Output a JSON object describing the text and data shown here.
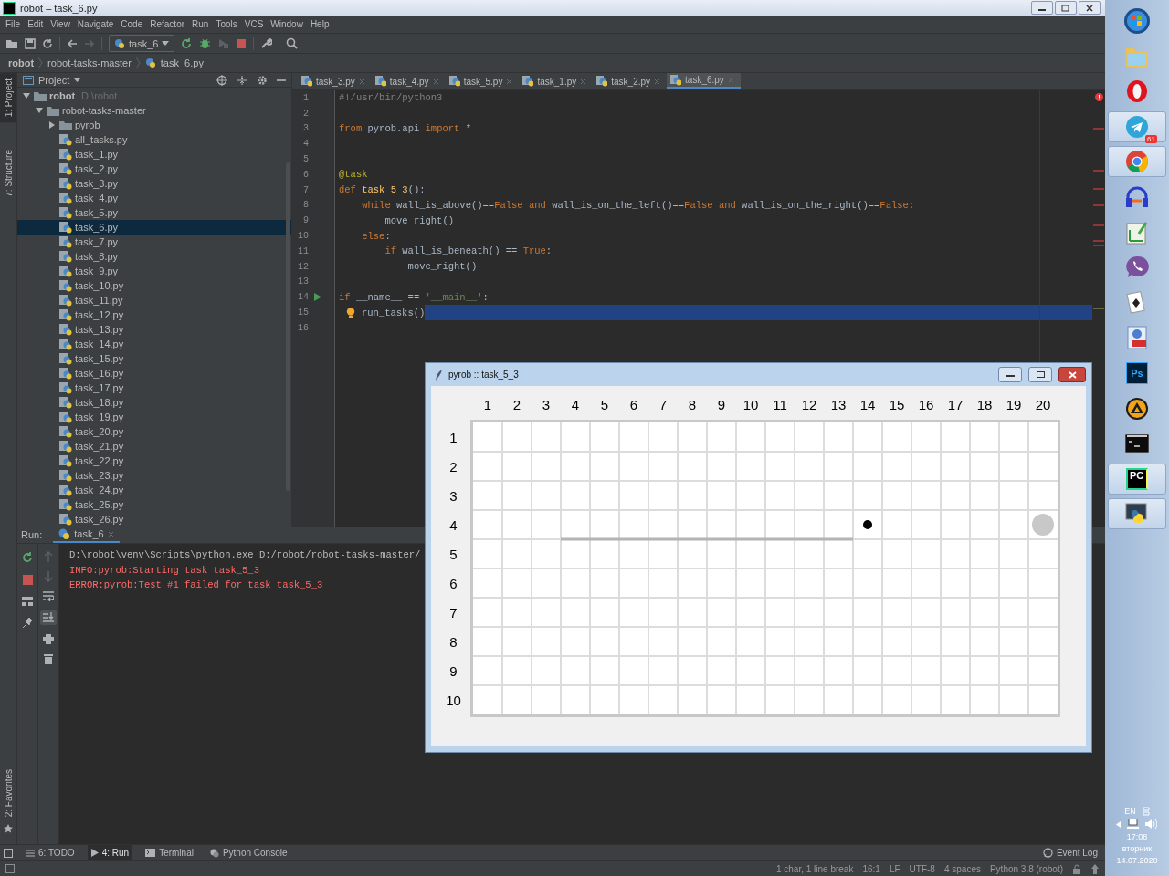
{
  "window": {
    "title": "robot – task_6.py"
  },
  "menu": [
    "File",
    "Edit",
    "View",
    "Navigate",
    "Code",
    "Refactor",
    "Run",
    "Tools",
    "VCS",
    "Window",
    "Help"
  ],
  "toolbar": {
    "run_config": "task_6"
  },
  "breadcrumbs": [
    "robot",
    "robot-tasks-master",
    "task_6.py"
  ],
  "side_tabs": [
    {
      "label": "1: Project",
      "selected": true
    },
    {
      "label": "7: Structure",
      "selected": false
    }
  ],
  "favorites": {
    "label": "2: Favorites"
  },
  "project": {
    "title": "Project",
    "tree": [
      {
        "name": "robot",
        "path": "D:\\robot",
        "kind": "folder",
        "expanded": true,
        "selected": false,
        "children": [
          {
            "name": "robot-tasks-master",
            "kind": "folder",
            "expanded": true,
            "selected": false,
            "children": [
              {
                "name": "pyrob",
                "kind": "folder",
                "expanded": false,
                "selected": false
              },
              {
                "name": "all_tasks.py",
                "kind": "file",
                "selected": false
              },
              {
                "name": "task_1.py",
                "kind": "file",
                "selected": false
              },
              {
                "name": "task_2.py",
                "kind": "file",
                "selected": false
              },
              {
                "name": "task_3.py",
                "kind": "file",
                "selected": false
              },
              {
                "name": "task_4.py",
                "kind": "file",
                "selected": false
              },
              {
                "name": "task_5.py",
                "kind": "file",
                "selected": false
              },
              {
                "name": "task_6.py",
                "kind": "file",
                "selected": true
              },
              {
                "name": "task_7.py",
                "kind": "file",
                "selected": false
              },
              {
                "name": "task_8.py",
                "kind": "file",
                "selected": false
              },
              {
                "name": "task_9.py",
                "kind": "file",
                "selected": false
              },
              {
                "name": "task_10.py",
                "kind": "file",
                "selected": false
              },
              {
                "name": "task_11.py",
                "kind": "file",
                "selected": false
              },
              {
                "name": "task_12.py",
                "kind": "file",
                "selected": false
              },
              {
                "name": "task_13.py",
                "kind": "file",
                "selected": false
              },
              {
                "name": "task_14.py",
                "kind": "file",
                "selected": false
              },
              {
                "name": "task_15.py",
                "kind": "file",
                "selected": false
              },
              {
                "name": "task_16.py",
                "kind": "file",
                "selected": false
              },
              {
                "name": "task_17.py",
                "kind": "file",
                "selected": false
              },
              {
                "name": "task_18.py",
                "kind": "file",
                "selected": false
              },
              {
                "name": "task_19.py",
                "kind": "file",
                "selected": false
              },
              {
                "name": "task_20.py",
                "kind": "file",
                "selected": false
              },
              {
                "name": "task_21.py",
                "kind": "file",
                "selected": false
              },
              {
                "name": "task_22.py",
                "kind": "file",
                "selected": false
              },
              {
                "name": "task_23.py",
                "kind": "file",
                "selected": false
              },
              {
                "name": "task_24.py",
                "kind": "file",
                "selected": false
              },
              {
                "name": "task_25.py",
                "kind": "file",
                "selected": false
              },
              {
                "name": "task_26.py",
                "kind": "file",
                "selected": false
              }
            ]
          }
        ]
      }
    ]
  },
  "editor_tabs": [
    {
      "label": "task_3.py",
      "selected": false
    },
    {
      "label": "task_4.py",
      "selected": false
    },
    {
      "label": "task_5.py",
      "selected": false
    },
    {
      "label": "task_1.py",
      "selected": false
    },
    {
      "label": "task_2.py",
      "selected": false
    },
    {
      "label": "task_6.py",
      "selected": true
    }
  ],
  "code": [
    {
      "number": "1",
      "kind": "plain",
      "selected": false,
      "tokens": [
        {
          "text": "#!/usr/bin/python3",
          "kind": "comment"
        }
      ]
    },
    {
      "number": "2",
      "kind": "plain",
      "selected": false
    },
    {
      "number": "3",
      "kind": "plain",
      "selected": false,
      "tokens": [
        {
          "text": "from",
          "kind": "keyword"
        },
        {
          "text": " pyrob.api ",
          "kind": "plain"
        },
        {
          "text": "import",
          "kind": "keyword"
        },
        {
          "text": " *",
          "kind": "plain"
        }
      ]
    },
    {
      "number": "4",
      "kind": "plain",
      "selected": false
    },
    {
      "number": "5",
      "kind": "plain",
      "selected": false
    },
    {
      "number": "6",
      "kind": "plain",
      "selected": false,
      "tokens": [
        {
          "text": "@task",
          "kind": "decorator"
        }
      ]
    },
    {
      "number": "7",
      "kind": "plain",
      "selected": false,
      "tokens": [
        {
          "text": "def",
          "kind": "keyword"
        },
        {
          "text": " task_5_3",
          "kind": "function"
        },
        {
          "text": "():",
          "kind": "plain"
        }
      ]
    },
    {
      "number": "8",
      "kind": "plain",
      "selected": false,
      "tokens": [
        {
          "text": "    while",
          "kind": "keyword"
        },
        {
          "text": " wall_is_above()==",
          "kind": "plain"
        },
        {
          "text": "False and",
          "kind": "keyword"
        },
        {
          "text": " wall_is_on_the_left()==",
          "kind": "plain"
        },
        {
          "text": "False and",
          "kind": "keyword"
        },
        {
          "text": " wall_is_on_the_right()==",
          "kind": "plain"
        },
        {
          "text": "False",
          "kind": "keyword"
        },
        {
          "text": ":",
          "kind": "plain"
        }
      ]
    },
    {
      "number": "9",
      "kind": "plain",
      "selected": false,
      "tokens": [
        {
          "text": "        move_right()",
          "kind": "plain"
        }
      ]
    },
    {
      "number": "10",
      "kind": "plain",
      "selected": false,
      "tokens": [
        {
          "text": "    else",
          "kind": "keyword"
        },
        {
          "text": ":",
          "kind": "plain"
        }
      ]
    },
    {
      "number": "11",
      "kind": "plain",
      "selected": false,
      "tokens": [
        {
          "text": "        if",
          "kind": "keyword"
        },
        {
          "text": " wall_is_beneath() == ",
          "kind": "plain"
        },
        {
          "text": "True",
          "kind": "keyword"
        },
        {
          "text": ":",
          "kind": "plain"
        }
      ]
    },
    {
      "number": "12",
      "kind": "plain",
      "selected": false,
      "tokens": [
        {
          "text": "            move_right()",
          "kind": "plain"
        }
      ]
    },
    {
      "number": "13",
      "kind": "plain",
      "selected": false
    },
    {
      "number": "14",
      "kind": "runnable",
      "selected": false,
      "tokens": [
        {
          "text": "if",
          "kind": "keyword"
        },
        {
          "text": " __name__ == ",
          "kind": "plain"
        },
        {
          "text": "'__main__'",
          "kind": "string"
        },
        {
          "text": ":",
          "kind": "plain"
        }
      ]
    },
    {
      "number": "15",
      "kind": "hint",
      "selected": true,
      "tokens": [
        {
          "text": "run_tasks()",
          "kind": "plain"
        }
      ]
    },
    {
      "number": "16",
      "kind": "plain",
      "selected": false
    }
  ],
  "run": {
    "label": "Run:",
    "tab": "task_6",
    "console": [
      {
        "text": "D:\\robot\\venv\\Scripts\\python.exe D:/robot/robot-tasks-master/",
        "kind": "stdout"
      },
      {
        "text": "INFO:pyrob:Starting task task_5_3",
        "kind": "stderr"
      },
      {
        "text": "ERROR:pyrob:Test #1 failed for task task_5_3",
        "kind": "stderr"
      }
    ]
  },
  "bottom_tabs": [
    {
      "label": "6: TODO",
      "kind": "todo",
      "selected": false
    },
    {
      "label": "4: Run",
      "kind": "run",
      "selected": true
    },
    {
      "label": "Terminal",
      "kind": "terminal",
      "selected": false
    },
    {
      "label": "Python Console",
      "kind": "console",
      "selected": false
    }
  ],
  "event_log": "Event Log",
  "status_bar": [
    "1 char, 1 line break",
    "16:1",
    "LF",
    "UTF-8",
    "4 spaces",
    "Python 3.8 (robot)"
  ],
  "robot_window": {
    "title": "pyrob :: task_5_3",
    "columns": [
      "1",
      "2",
      "3",
      "4",
      "5",
      "6",
      "7",
      "8",
      "9",
      "10",
      "11",
      "12",
      "13",
      "14",
      "15",
      "16",
      "17",
      "18",
      "19",
      "20"
    ],
    "rows": [
      {
        "label": "1",
        "cells": [
          {
            "kind": "empty"
          },
          {
            "kind": "empty"
          },
          {
            "kind": "empty"
          },
          {
            "kind": "empty"
          },
          {
            "kind": "empty"
          },
          {
            "kind": "empty"
          },
          {
            "kind": "empty"
          },
          {
            "kind": "empty"
          },
          {
            "kind": "empty"
          },
          {
            "kind": "empty"
          },
          {
            "kind": "empty"
          },
          {
            "kind": "empty"
          },
          {
            "kind": "empty"
          },
          {
            "kind": "empty"
          },
          {
            "kind": "empty"
          },
          {
            "kind": "empty"
          },
          {
            "kind": "empty"
          },
          {
            "kind": "empty"
          },
          {
            "kind": "empty"
          },
          {
            "kind": "empty"
          }
        ]
      },
      {
        "label": "2",
        "cells": [
          {
            "kind": "empty"
          },
          {
            "kind": "empty"
          },
          {
            "kind": "empty"
          },
          {
            "kind": "empty"
          },
          {
            "kind": "empty"
          },
          {
            "kind": "empty"
          },
          {
            "kind": "empty"
          },
          {
            "kind": "empty"
          },
          {
            "kind": "empty"
          },
          {
            "kind": "empty"
          },
          {
            "kind": "empty"
          },
          {
            "kind": "empty"
          },
          {
            "kind": "empty"
          },
          {
            "kind": "empty"
          },
          {
            "kind": "empty"
          },
          {
            "kind": "empty"
          },
          {
            "kind": "empty"
          },
          {
            "kind": "empty"
          },
          {
            "kind": "empty"
          },
          {
            "kind": "empty"
          }
        ]
      },
      {
        "label": "3",
        "cells": [
          {
            "kind": "empty"
          },
          {
            "kind": "empty"
          },
          {
            "kind": "empty"
          },
          {
            "kind": "empty"
          },
          {
            "kind": "empty"
          },
          {
            "kind": "empty"
          },
          {
            "kind": "empty"
          },
          {
            "kind": "empty"
          },
          {
            "kind": "empty"
          },
          {
            "kind": "empty"
          },
          {
            "kind": "empty"
          },
          {
            "kind": "empty"
          },
          {
            "kind": "empty"
          },
          {
            "kind": "empty"
          },
          {
            "kind": "empty"
          },
          {
            "kind": "empty"
          },
          {
            "kind": "empty"
          },
          {
            "kind": "empty"
          },
          {
            "kind": "empty"
          },
          {
            "kind": "empty"
          }
        ]
      },
      {
        "label": "4",
        "cells": [
          {
            "kind": "empty"
          },
          {
            "kind": "empty"
          },
          {
            "kind": "empty"
          },
          {
            "kind": "wall_below"
          },
          {
            "kind": "wall_below"
          },
          {
            "kind": "wall_below"
          },
          {
            "kind": "wall_below"
          },
          {
            "kind": "wall_below"
          },
          {
            "kind": "wall_below"
          },
          {
            "kind": "wall_below"
          },
          {
            "kind": "wall_below"
          },
          {
            "kind": "wall_below"
          },
          {
            "kind": "wall_below"
          },
          {
            "kind": "robot"
          },
          {
            "kind": "empty"
          },
          {
            "kind": "empty"
          },
          {
            "kind": "empty"
          },
          {
            "kind": "empty"
          },
          {
            "kind": "empty"
          },
          {
            "kind": "target"
          }
        ]
      },
      {
        "label": "5",
        "cells": [
          {
            "kind": "empty"
          },
          {
            "kind": "empty"
          },
          {
            "kind": "empty"
          },
          {
            "kind": "empty"
          },
          {
            "kind": "empty"
          },
          {
            "kind": "empty"
          },
          {
            "kind": "empty"
          },
          {
            "kind": "empty"
          },
          {
            "kind": "empty"
          },
          {
            "kind": "empty"
          },
          {
            "kind": "empty"
          },
          {
            "kind": "empty"
          },
          {
            "kind": "empty"
          },
          {
            "kind": "empty"
          },
          {
            "kind": "empty"
          },
          {
            "kind": "empty"
          },
          {
            "kind": "empty"
          },
          {
            "kind": "empty"
          },
          {
            "kind": "empty"
          },
          {
            "kind": "empty"
          }
        ]
      },
      {
        "label": "6",
        "cells": [
          {
            "kind": "empty"
          },
          {
            "kind": "empty"
          },
          {
            "kind": "empty"
          },
          {
            "kind": "empty"
          },
          {
            "kind": "empty"
          },
          {
            "kind": "empty"
          },
          {
            "kind": "empty"
          },
          {
            "kind": "empty"
          },
          {
            "kind": "empty"
          },
          {
            "kind": "empty"
          },
          {
            "kind": "empty"
          },
          {
            "kind": "empty"
          },
          {
            "kind": "empty"
          },
          {
            "kind": "empty"
          },
          {
            "kind": "empty"
          },
          {
            "kind": "empty"
          },
          {
            "kind": "empty"
          },
          {
            "kind": "empty"
          },
          {
            "kind": "empty"
          },
          {
            "kind": "empty"
          }
        ]
      },
      {
        "label": "7",
        "cells": [
          {
            "kind": "empty"
          },
          {
            "kind": "empty"
          },
          {
            "kind": "empty"
          },
          {
            "kind": "empty"
          },
          {
            "kind": "empty"
          },
          {
            "kind": "empty"
          },
          {
            "kind": "empty"
          },
          {
            "kind": "empty"
          },
          {
            "kind": "empty"
          },
          {
            "kind": "empty"
          },
          {
            "kind": "empty"
          },
          {
            "kind": "empty"
          },
          {
            "kind": "empty"
          },
          {
            "kind": "empty"
          },
          {
            "kind": "empty"
          },
          {
            "kind": "empty"
          },
          {
            "kind": "empty"
          },
          {
            "kind": "empty"
          },
          {
            "kind": "empty"
          },
          {
            "kind": "empty"
          }
        ]
      },
      {
        "label": "8",
        "cells": [
          {
            "kind": "empty"
          },
          {
            "kind": "empty"
          },
          {
            "kind": "empty"
          },
          {
            "kind": "empty"
          },
          {
            "kind": "empty"
          },
          {
            "kind": "empty"
          },
          {
            "kind": "empty"
          },
          {
            "kind": "empty"
          },
          {
            "kind": "empty"
          },
          {
            "kind": "empty"
          },
          {
            "kind": "empty"
          },
          {
            "kind": "empty"
          },
          {
            "kind": "empty"
          },
          {
            "kind": "empty"
          },
          {
            "kind": "empty"
          },
          {
            "kind": "empty"
          },
          {
            "kind": "empty"
          },
          {
            "kind": "empty"
          },
          {
            "kind": "empty"
          },
          {
            "kind": "empty"
          }
        ]
      },
      {
        "label": "9",
        "cells": [
          {
            "kind": "empty"
          },
          {
            "kind": "empty"
          },
          {
            "kind": "empty"
          },
          {
            "kind": "empty"
          },
          {
            "kind": "empty"
          },
          {
            "kind": "empty"
          },
          {
            "kind": "empty"
          },
          {
            "kind": "empty"
          },
          {
            "kind": "empty"
          },
          {
            "kind": "empty"
          },
          {
            "kind": "empty"
          },
          {
            "kind": "empty"
          },
          {
            "kind": "empty"
          },
          {
            "kind": "empty"
          },
          {
            "kind": "empty"
          },
          {
            "kind": "empty"
          },
          {
            "kind": "empty"
          },
          {
            "kind": "empty"
          },
          {
            "kind": "empty"
          },
          {
            "kind": "empty"
          }
        ]
      },
      {
        "label": "10",
        "cells": [
          {
            "kind": "empty"
          },
          {
            "kind": "empty"
          },
          {
            "kind": "empty"
          },
          {
            "kind": "empty"
          },
          {
            "kind": "empty"
          },
          {
            "kind": "empty"
          },
          {
            "kind": "empty"
          },
          {
            "kind": "empty"
          },
          {
            "kind": "empty"
          },
          {
            "kind": "empty"
          },
          {
            "kind": "empty"
          },
          {
            "kind": "empty"
          },
          {
            "kind": "empty"
          },
          {
            "kind": "empty"
          },
          {
            "kind": "empty"
          },
          {
            "kind": "empty"
          },
          {
            "kind": "empty"
          },
          {
            "kind": "empty"
          },
          {
            "kind": "empty"
          },
          {
            "kind": "empty"
          }
        ]
      }
    ]
  },
  "taskbar": {
    "apps": [
      {
        "kind": "start",
        "selected": false
      },
      {
        "kind": "folder",
        "selected": false
      },
      {
        "kind": "opera",
        "selected": false
      },
      {
        "kind": "telegram",
        "selected": true,
        "badge": "61"
      },
      {
        "kind": "chrome",
        "selected": true
      },
      {
        "kind": "audio",
        "selected": false
      },
      {
        "kind": "chart",
        "selected": false
      },
      {
        "kind": "viber",
        "selected": false
      },
      {
        "kind": "cards",
        "selected": false
      },
      {
        "kind": "pdf",
        "selected": false
      },
      {
        "kind": "photoshop",
        "selected": false,
        "label": "Ps"
      },
      {
        "kind": "player",
        "selected": false
      },
      {
        "kind": "cmd",
        "selected": false
      },
      {
        "kind": "pycharm",
        "selected": true,
        "label": "PC"
      },
      {
        "kind": "python",
        "selected": true
      }
    ],
    "tray": {
      "language": "EN",
      "time": "17:08",
      "day": "вторник",
      "date": "14.07.2020"
    }
  }
}
